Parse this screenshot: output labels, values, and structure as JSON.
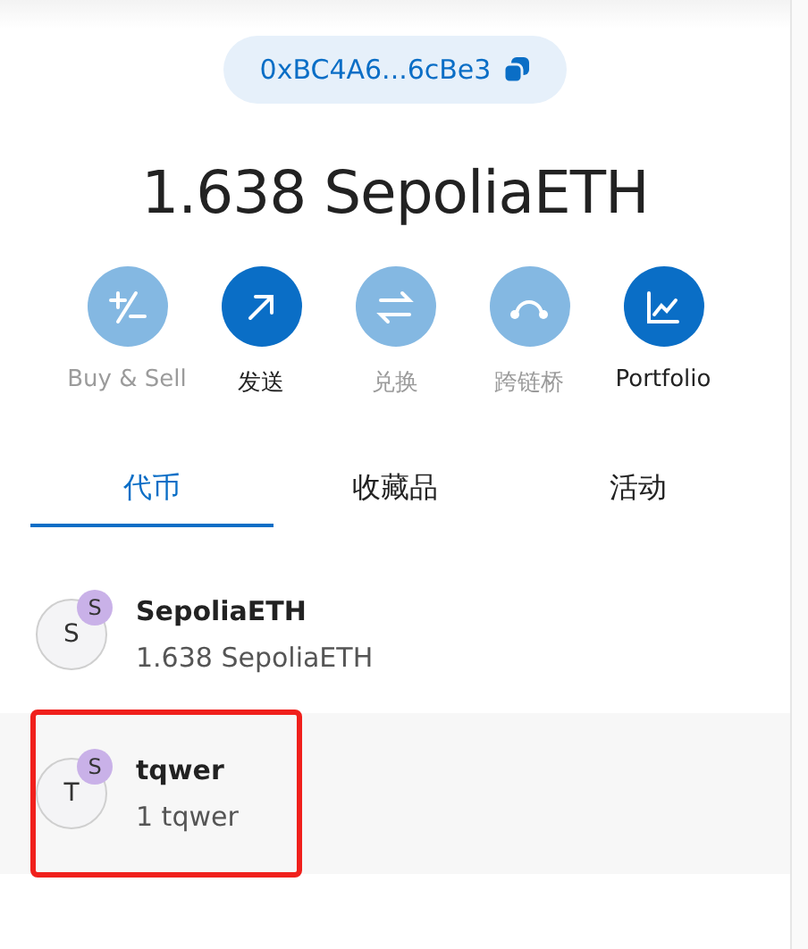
{
  "account": {
    "address": "0xBC4A6...6cBe3"
  },
  "balance": "1.638 SepoliaETH",
  "actions": [
    {
      "kind": "buy",
      "label": "Buy & Sell",
      "disabled": true
    },
    {
      "kind": "send",
      "label": "发送",
      "disabled": false
    },
    {
      "kind": "swap",
      "label": "兑换",
      "disabled": true
    },
    {
      "kind": "bridge",
      "label": "跨链桥",
      "disabled": true
    },
    {
      "kind": "portfolio",
      "label": "Portfolio",
      "disabled": false
    }
  ],
  "tabs": [
    {
      "label": "代币",
      "selected": true
    },
    {
      "label": "收藏品",
      "selected": false
    },
    {
      "label": "活动",
      "selected": false
    }
  ],
  "tokens": [
    {
      "initial": "S",
      "network": "S",
      "name": "SepoliaETH",
      "amount": "1.638 SepoliaETH",
      "highlighted": false
    },
    {
      "initial": "T",
      "network": "S",
      "name": "tqwer",
      "amount": "1 tqwer",
      "highlighted": true
    }
  ]
}
